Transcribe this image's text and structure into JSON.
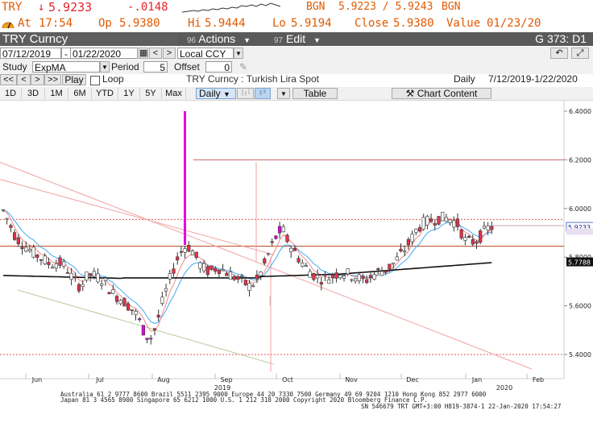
{
  "quote": {
    "ticker": "TRY",
    "last_price": "5.9233",
    "change": "-.0148",
    "bid_source": "BGN",
    "bid_ask": "5.9223 / 5.9243",
    "ask_source": "BGN",
    "at_label": "At",
    "time": "17:54",
    "open_label": "Op",
    "open": "5.9380",
    "high_label": "Hi",
    "high": "5.9444",
    "low_label": "Lo",
    "low": "5.9194",
    "close_label": "Close",
    "close": "5.9380",
    "value_label": "Value",
    "value_date": "01/23/20"
  },
  "title_bar": {
    "security": "TRY  Curncy",
    "actions_num": "96",
    "actions_label": "Actions",
    "edit_num": "97",
    "edit_label": "Edit",
    "page_code": "G 373: D1"
  },
  "controls": {
    "date_from": "07/12/2019",
    "date_to": "01/22/2020",
    "currency": "Local CCY",
    "study_label": "Study",
    "study_value": "ExpMA",
    "period_label": "Period",
    "period_value": "5",
    "offset_label": "Offset",
    "offset_value": "0",
    "play_label": "Play",
    "loop_label": "Loop",
    "security_desc": "TRY  Curncy : Turkish Lira Spot",
    "frequency": "Daily",
    "range": "7/12/2019-1/22/2020"
  },
  "timeframes": [
    "1D",
    "3D",
    "1M",
    "6M",
    "YTD",
    "1Y",
    "5Y",
    "Max"
  ],
  "toolbar": {
    "period_select": "Daily",
    "table_label": "Table",
    "chart_content_label": "Chart Content"
  },
  "footer": {
    "line1": "Australia 61 2 9777 8600 Brazil 5511 2395 9000 Europe 44 20 7330 7500 Germany 49 69 9204 1210 Hong Kong 852 2977 6000",
    "line2": "Japan 81 3 4565 8900        Singapore 65 6212 1000        U.S. 1 212 318 2000                Copyright 2020 Bloomberg Finance L.P.",
    "line3": "SN 546679 TRT  GMT+3:00 H819-3874-1 22-Jan-2020 17:54:27"
  },
  "chart_data": {
    "type": "candlestick",
    "x_labels": [
      "Jun",
      "Jul",
      "Aug",
      "Sep",
      "Oct",
      "Nov",
      "Dec",
      "Jan",
      "Feb"
    ],
    "year_labels": [
      "2019",
      "2020"
    ],
    "y_ticks": [
      "6.4000",
      "6.2000",
      "6.0000",
      "5.8000",
      "5.6000",
      "5.4000"
    ],
    "ylim": [
      5.33,
      6.42
    ],
    "last_price_label": "5.9233",
    "ema_label": "5.7788",
    "hline_value": 6.2,
    "dotted_values": [
      5.955,
      5.4
    ]
  },
  "colors": {
    "up": "#ffffff",
    "down": "#e8304a",
    "wick": "#333333",
    "ema_slow": "#111111",
    "ema_fast": "#3fa9f5",
    "magenta": "#e600e6",
    "price_negative": "#e2252a",
    "quote_orange": "#e05a00"
  }
}
